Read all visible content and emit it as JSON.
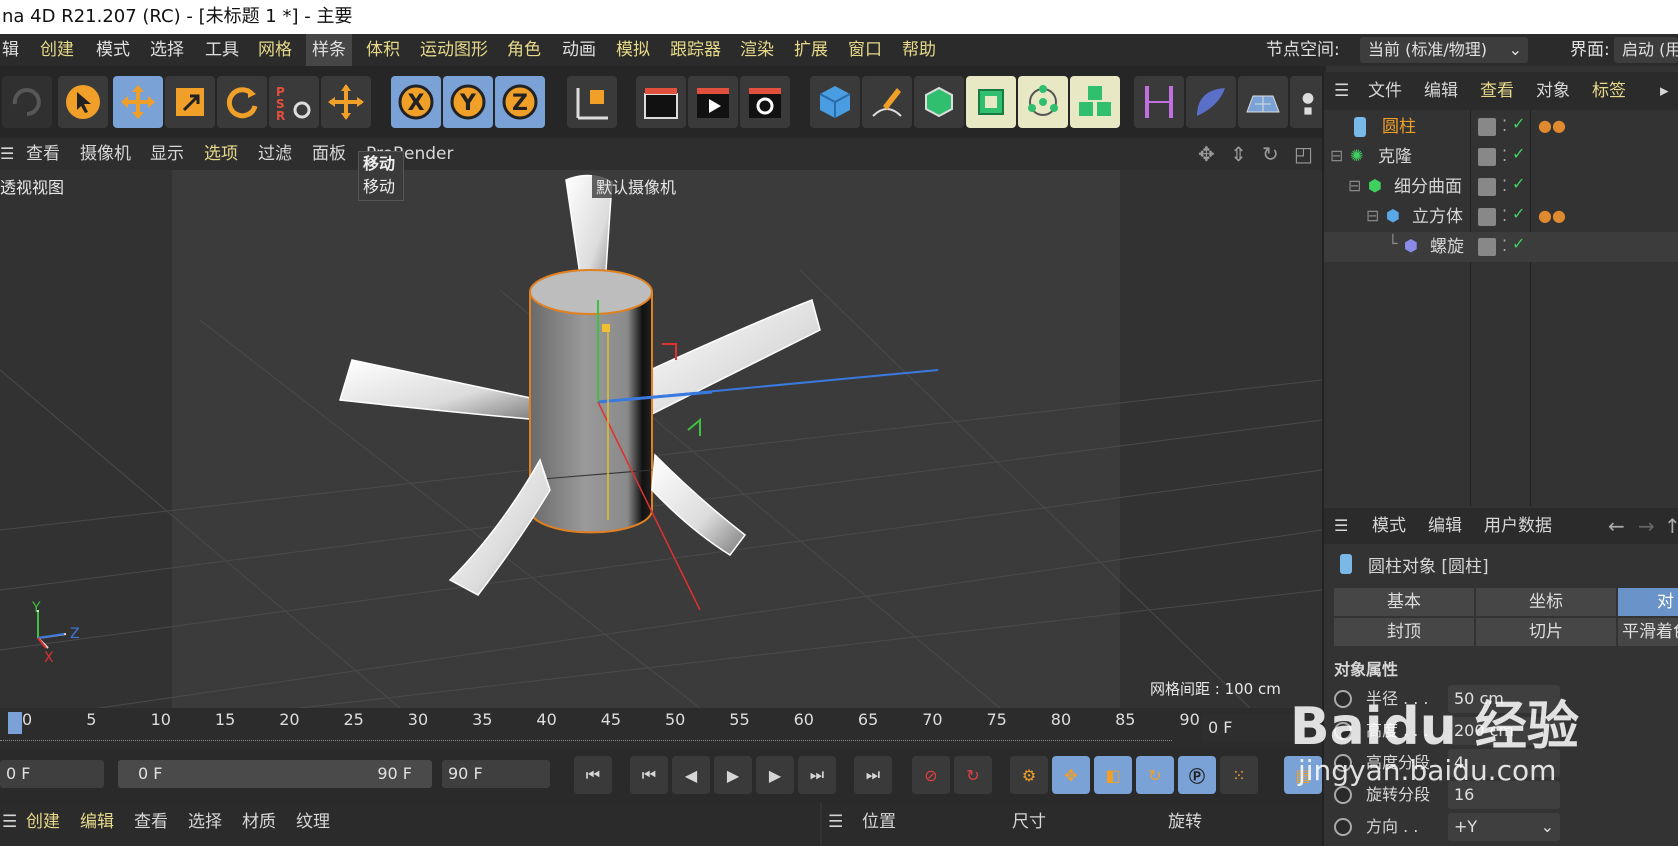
{
  "window": {
    "title": "na 4D R21.207 (RC) - [未标题 1 *] - 主要"
  },
  "menubar": {
    "items": [
      "辑",
      "创建",
      "模式",
      "选择",
      "工具",
      "网格",
      "样条",
      "体积",
      "运动图形",
      "角色",
      "动画",
      "模拟",
      "跟踪器",
      "渲染",
      "扩展",
      "窗口",
      "帮助"
    ],
    "node_space_label": "节点空间:",
    "node_space_value": "当前 (标准/物理)",
    "layout_label": "界面:",
    "layout_value": "启动 (用"
  },
  "viewport_menu": {
    "items": [
      "查看",
      "摄像机",
      "显示",
      "选项",
      "过滤",
      "面板",
      "ProRender"
    ]
  },
  "tooltip": {
    "title": "移动",
    "body": "移动"
  },
  "viewport": {
    "view_name": "透视视图",
    "camera_label": "默认摄像机",
    "grid_spacing": "网格间距 : 100 cm",
    "axes": {
      "y": "Y",
      "z": "Z",
      "x": "X"
    }
  },
  "timeline": {
    "ticks": [
      "0",
      "5",
      "10",
      "15",
      "20",
      "25",
      "30",
      "35",
      "40",
      "45",
      "50",
      "55",
      "60",
      "65",
      "70",
      "75",
      "80",
      "85",
      "90"
    ],
    "current_frame": "0 F"
  },
  "transport": {
    "start_frame": "0 F",
    "range_start": "0 F",
    "range_end": "90 F",
    "end_frame": "90 F"
  },
  "material_menu": {
    "items": [
      "创建",
      "编辑",
      "查看",
      "选择",
      "材质",
      "纹理"
    ]
  },
  "coord_menu": {
    "items": [
      "位置",
      "尺寸",
      "旋转"
    ]
  },
  "object_manager": {
    "menu": [
      "文件",
      "编辑",
      "查看",
      "对象",
      "标签"
    ],
    "objects": [
      {
        "name": "圆柱",
        "selected": true
      },
      {
        "name": "克隆",
        "selected": false
      },
      {
        "name": "细分曲面",
        "selected": false
      },
      {
        "name": "立方体",
        "selected": false
      },
      {
        "name": "螺旋",
        "selected": false
      }
    ]
  },
  "attribute_manager": {
    "menu": [
      "模式",
      "编辑",
      "用户数据"
    ],
    "object_title": "圆柱对象 [圆柱]",
    "tabs_row1": [
      "基本",
      "坐标",
      "对"
    ],
    "tabs_row2": [
      "封顶",
      "切片",
      "平滑着色"
    ],
    "section": "对象属性",
    "fields": [
      {
        "label": "半径 . . .",
        "value": "50 cm"
      },
      {
        "label": "高度 . . .",
        "value": "200 cm"
      },
      {
        "label": "高度分段",
        "value": "4"
      },
      {
        "label": "旋转分段",
        "value": "16"
      },
      {
        "label": "方向 . .",
        "value": "+Y"
      }
    ]
  },
  "watermark": {
    "brand": "Baidu 经验",
    "url": "jingyan.baidu.com"
  },
  "colors": {
    "accent_yellow": "#e6d98a",
    "selected_orange": "#f0a028",
    "active_blue": "#7aa2d6"
  }
}
